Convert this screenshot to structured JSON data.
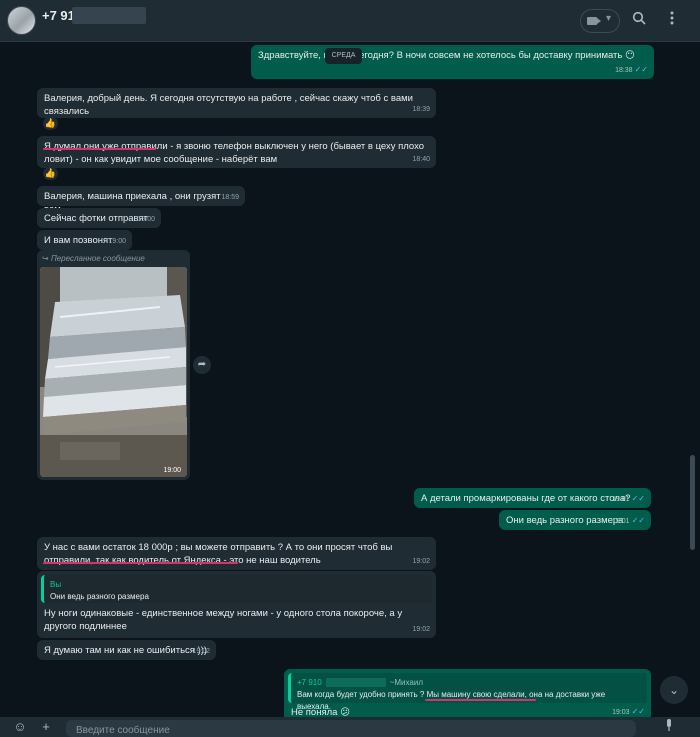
{
  "header": {
    "contact_name": "+7 910",
    "icons": [
      "video-call-icon",
      "chevron-down-icon",
      "search-icon",
      "more-options-icon"
    ]
  },
  "date_divider": "СРЕДА",
  "messages": [
    {
      "dir": "out",
      "text": "Здравствуйте, на       вас сегодня? В ночи совсем не хотелось бы доставку принимать 😶",
      "time": "18:38"
    },
    {
      "dir": "in",
      "text": "Валерия, добрый день. Я сегодня отсутствую на работе , сейчас скажу чтоб с вами связались",
      "time": "18:39",
      "reaction": "👍"
    },
    {
      "dir": "in",
      "text": "Я думал они уже отправили - я звоню телефон выключен у него (бывает в цеху плохо ловит) - он как увидит мое сообщение - наберёт вам",
      "time": "18:40",
      "reaction": "👍"
    },
    {
      "dir": "in",
      "text": "Валерия, машина приехала , они грузят вам",
      "time": "18:59"
    },
    {
      "dir": "in",
      "text": "Сейчас фотки отправят",
      "time": "19:00"
    },
    {
      "dir": "in",
      "text": "И вам позвонят",
      "time": "19:00"
    },
    {
      "dir": "in",
      "type": "photo",
      "forwarded_label": "Пересланное сообщение",
      "time": "19:00"
    },
    {
      "dir": "out",
      "text": "А детали промаркированы где от какого стола?",
      "time": "19:01"
    },
    {
      "dir": "out",
      "text": "Они ведь разного размера",
      "time": "19:01"
    },
    {
      "dir": "in",
      "text": "У нас с вами остаток 18 000р ; вы можете отправить ? А то они просят чтоб вы отправили, так как водитель от Яндекса - это не наш водитель",
      "time": "19:02"
    },
    {
      "dir": "in",
      "quote_name": "Вы",
      "quote_text": "Они ведь разного размера",
      "text": "Ну ноги одинаковые - единственное между ногами - у одного стола покороче, а у другого подлиннее",
      "time": "19:02"
    },
    {
      "dir": "in",
      "text": "Я думаю там ни как не ошибиться )))",
      "time": "19:02"
    },
    {
      "dir": "out",
      "quote_name": "+7 910",
      "quote_author": "~Михаил",
      "quote_text": "Вам когда будет удобно принять ? Мы машину свою сделали, она на доставки уже выехала.",
      "text": "Не поняла 😕",
      "time": "19:03"
    }
  ],
  "composer": {
    "placeholder": "Введите сообщение"
  },
  "footer_icons": [
    "emoji-icon",
    "attach-plus-icon",
    "microphone-icon"
  ],
  "colors": {
    "background": "#0b141a",
    "incoming_bubble": "#202c33",
    "outgoing_bubble": "#005c4b",
    "read_tick": "#53bdeb",
    "annotation_underline": "#d6336c"
  }
}
